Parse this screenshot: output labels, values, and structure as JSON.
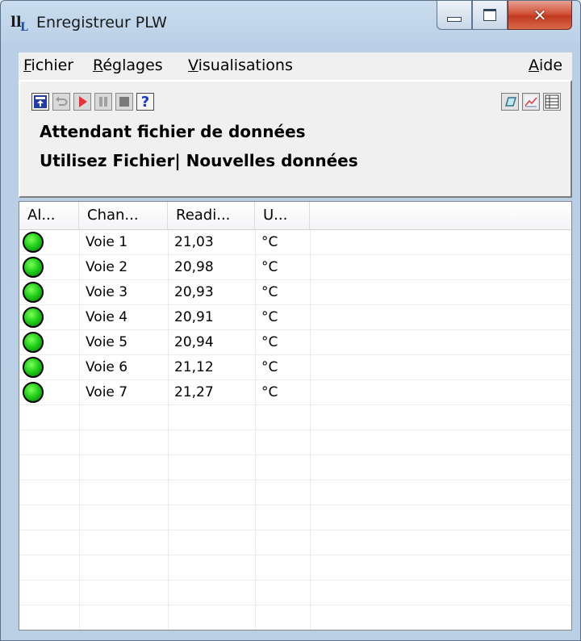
{
  "window": {
    "title": "Enregistreur PLW",
    "app_icon": "PLW-logo-icon"
  },
  "menu": {
    "file": {
      "underline": "F",
      "rest": "ichier"
    },
    "settings": {
      "underline": "R",
      "rest": "églages"
    },
    "views": {
      "underline": "V",
      "rest": "isualisations"
    },
    "help": {
      "underline": "A",
      "rest": "ide"
    }
  },
  "toolbar": {
    "left_icons": [
      "open-file-icon",
      "undo-icon",
      "record-icon",
      "pause-icon",
      "stop-icon",
      "help-icon"
    ],
    "help_label": "?",
    "right_icons": [
      "xy-graph-icon",
      "graph-icon",
      "spreadsheet-icon"
    ]
  },
  "status": {
    "line1": "Attendant fichier de données",
    "line2": "Utilisez Fichier| Nouvelles données"
  },
  "table": {
    "columns": [
      "Al...",
      "Chan...",
      "Readi...",
      "U..."
    ],
    "rows": [
      {
        "alarm": "ok",
        "channel": "Voie 1",
        "reading": "21,03",
        "unit": "°C"
      },
      {
        "alarm": "ok",
        "channel": "Voie 2",
        "reading": "20,98",
        "unit": "°C"
      },
      {
        "alarm": "ok",
        "channel": "Voie 3",
        "reading": "20,93",
        "unit": "°C"
      },
      {
        "alarm": "ok",
        "channel": "Voie 4",
        "reading": "20,91",
        "unit": "°C"
      },
      {
        "alarm": "ok",
        "channel": "Voie 5",
        "reading": "20,94",
        "unit": "°C"
      },
      {
        "alarm": "ok",
        "channel": "Voie 6",
        "reading": "21,12",
        "unit": "°C"
      },
      {
        "alarm": "ok",
        "channel": "Voie 7",
        "reading": "21,27",
        "unit": "°C"
      }
    ]
  },
  "colors": {
    "alarm_ok": "#22d11a",
    "close_button": "#c13a1f"
  }
}
